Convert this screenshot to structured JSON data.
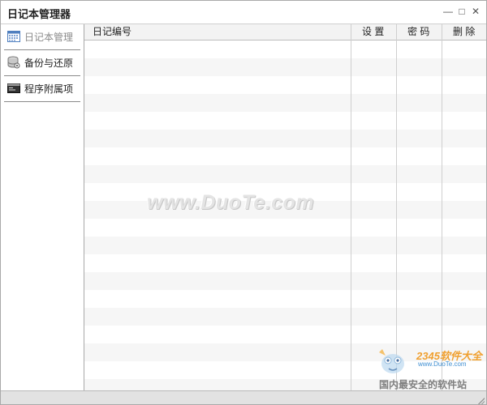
{
  "window": {
    "title": "日记本管理器",
    "controls": {
      "minimize": "—",
      "maximize": "□",
      "close": "✕"
    }
  },
  "sidebar": {
    "items": [
      {
        "label": "日记本管理",
        "icon": "calendar-grid-icon",
        "active": true
      },
      {
        "label": "备份与还原",
        "icon": "database-icon",
        "active": false
      },
      {
        "label": "程序附属项",
        "icon": "terminal-window-icon",
        "active": false
      }
    ]
  },
  "table": {
    "columns": [
      "日记编号",
      "设 置",
      "密 码",
      "删 除"
    ],
    "row_count": 20
  },
  "watermarks": {
    "center": "www.DuoTe.com",
    "brand": "2345软件大全",
    "url": "www.DuoTe.com",
    "slogan": "国内最安全的软件站"
  },
  "colors": {
    "accent_icon_blue": "#4f7fbf",
    "sidebar_border": "#a9a9a9",
    "status_bar": "#e2e2e2",
    "alt_row": "#f6f6f6"
  }
}
